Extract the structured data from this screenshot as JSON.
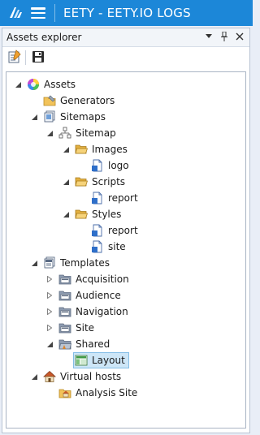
{
  "app": {
    "title": "EETY - EETY.IO LOGS"
  },
  "panel": {
    "title": "Assets explorer"
  },
  "tree": {
    "root": "Assets",
    "generators": "Generators",
    "sitemaps": "Sitemaps",
    "sitemap": "Sitemap",
    "images": "Images",
    "logo": "logo",
    "scripts": "Scripts",
    "scripts_report": "report",
    "styles": "Styles",
    "styles_report": "report",
    "styles_site": "site",
    "templates": "Templates",
    "acquisition": "Acquisition",
    "audience": "Audience",
    "navigation": "Navigation",
    "site": "Site",
    "shared": "Shared",
    "layout": "Layout",
    "virtual_hosts": "Virtual hosts",
    "analysis_site": "Analysis Site"
  },
  "colors": {
    "titlebar": "#1c87d8",
    "selection": "#cde6f7",
    "folder": "#e8b84a"
  }
}
